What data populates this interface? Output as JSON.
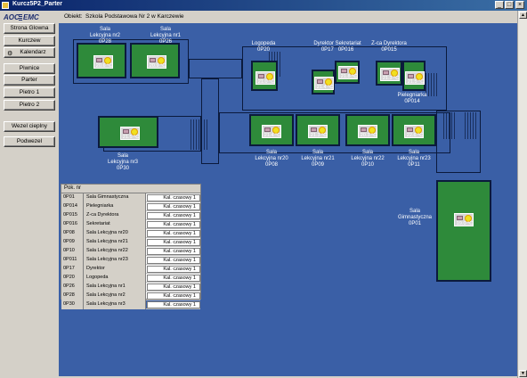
{
  "window": {
    "title": "Kurcz5P2_Parter",
    "minimize": "_",
    "maximize": "□",
    "close": "×"
  },
  "logo": {
    "left": "AOC",
    "right": "EMC"
  },
  "nav": {
    "home": "Strona Glowna",
    "kurczew": "Kurczew",
    "calendar": "Kalendarz",
    "piwnice": "Piwnice",
    "parter": "Parter",
    "pietro1": "Pietro 1",
    "pietro2": "Pietro 2",
    "heat_node": "Wezel cieplny",
    "podwezel": "Podwezel"
  },
  "header": {
    "label": "Obiekt:",
    "value": "Szkola Podstawowa Nr 2 w Karczewie"
  },
  "rooms": [
    {
      "name": "Sala\nLekcyjna nr2\n0P28",
      "temp": "20.6 °C"
    },
    {
      "name": "Sala\nLekcyjna nr1\n0P26",
      "temp": "20.9 °C"
    },
    {
      "name": "Logopeda\n0P20",
      "temp": "21.0 °C"
    },
    {
      "name": "Dyrektor Sekretariat\n0P17   0P016",
      "temp": "21.4 °C"
    },
    {
      "name": "",
      "temp": "21.8 °C"
    },
    {
      "name": "Z-ca Dyrektora\n0P015",
      "temp": "21.3 °C"
    },
    {
      "name": "Pielegniarka\n0P014",
      "temp": "21.5 °C"
    },
    {
      "name": "Sala\nLekcyjna nr3\n0P30",
      "temp": "21.5 °C"
    },
    {
      "name": "Sala\nLekcyjna nr20\n0P08",
      "temp": "21.4 °C"
    },
    {
      "name": "Sala\nLekcyjna nr21\n0P09",
      "temp": "21.3 °C"
    },
    {
      "name": "Sala\nLekcyjna nr22\n0P10",
      "temp": "20.3 °C"
    },
    {
      "name": "Sala\nLekcyjna nr23\n0P11",
      "temp": "22.6 °C"
    },
    {
      "name": "Sala\nGimnastyczna\n0P01",
      "temp": "19.0 °C"
    }
  ],
  "table": {
    "header": "Pok. nr",
    "rows": [
      {
        "id": "0P01",
        "name": "Sala Gimnastyczna",
        "schedule": "Kal. czasowy 1"
      },
      {
        "id": "0P014",
        "name": "Pielegniarka",
        "schedule": "Kal. czasowy 1"
      },
      {
        "id": "0P015",
        "name": "Z-ca Dyrektora",
        "schedule": "Kal. czasowy 1"
      },
      {
        "id": "0P016",
        "name": "Sekretariat",
        "schedule": "Kal. czasowy 1"
      },
      {
        "id": "0P08",
        "name": "Sala Lekcyjna nr20",
        "schedule": "Kal. czasowy 1"
      },
      {
        "id": "0P09",
        "name": "Sala Lekcyjna nr21",
        "schedule": "Kal. czasowy 1"
      },
      {
        "id": "0P10",
        "name": "Sala Lekcyjna nr22",
        "schedule": "Kal. czasowy 1"
      },
      {
        "id": "0P011",
        "name": "Sala Lekcyjna nr23",
        "schedule": "Kal. czasowy 1"
      },
      {
        "id": "0P17",
        "name": "Dyrektor",
        "schedule": "Kal. czasowy 1"
      },
      {
        "id": "0P20",
        "name": "Logopeda",
        "schedule": "Kal. czasowy 1"
      },
      {
        "id": "0P26",
        "name": "Sala Lekcyjna nr1",
        "schedule": "Kal. czasowy 1"
      },
      {
        "id": "0P28",
        "name": "Sala Lekcyjna nr2",
        "schedule": "Kal. czasowy 1"
      },
      {
        "id": "0P30",
        "name": "Sala Lekcyjna nr3",
        "schedule": "Kal. czasowy 1"
      }
    ]
  },
  "colors": {
    "background": "#3a5fa6",
    "room": "#2e8a3a",
    "wall": "#0b1a3c"
  }
}
